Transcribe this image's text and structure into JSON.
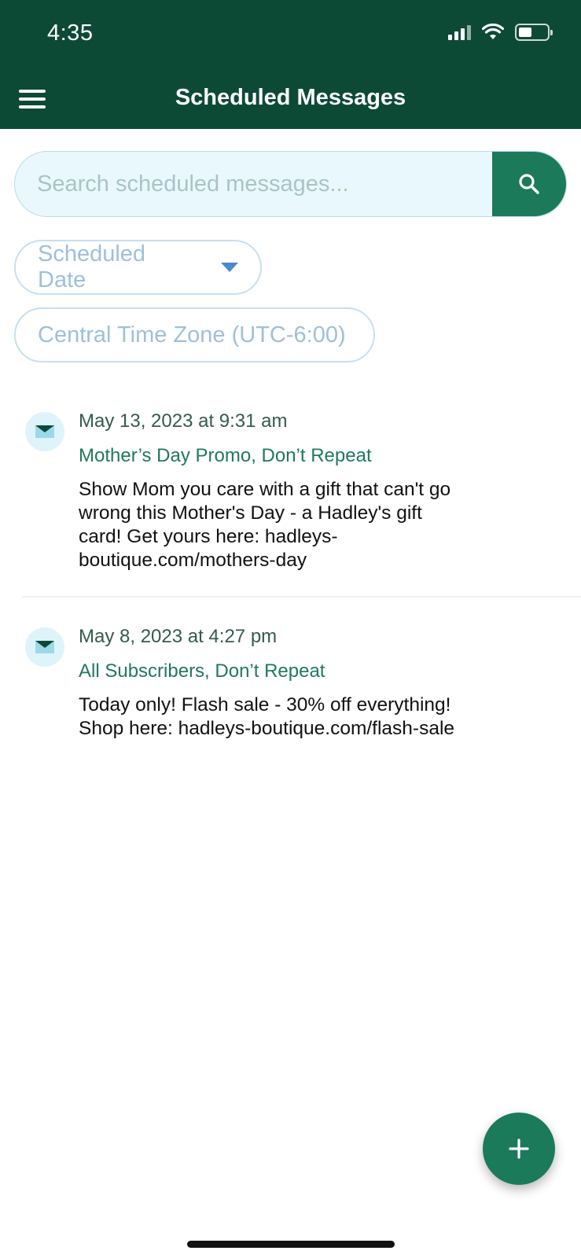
{
  "status_bar": {
    "time": "4:35",
    "icons": [
      "signal-icon",
      "wifi-icon",
      "battery-icon"
    ]
  },
  "app_bar": {
    "title": "Scheduled Messages",
    "menu_icon": "hamburger-menu-icon",
    "background_color": "#0d4a35"
  },
  "search": {
    "placeholder": "Search scheduled messages...",
    "value": "",
    "button_icon": "search-icon"
  },
  "filters": {
    "sort_by": "Scheduled Date",
    "time_zone": "Central Time Zone (UTC-6:00)"
  },
  "messages": [
    {
      "date": "May 13, 2023 at 9:31 am",
      "tags": "Mother’s Day Promo, Don’t Repeat",
      "body": "Show Mom you care with a gift that can't go wrong this Mother's Day - a Hadley's gift card! Get yours here: hadleys-boutique.com/mothers-day",
      "icon": "envelope-icon"
    },
    {
      "date": "May 8, 2023 at 4:27 pm",
      "tags": "All Subscribers, Don’t Repeat",
      "body": "Today only! Flash sale - 30% off everything! Shop here: hadleys-boutique.com/flash-sale",
      "icon": "envelope-icon"
    }
  ],
  "fab": {
    "icon": "plus-icon"
  },
  "colors": {
    "primary_dark": "#0d4a35",
    "accent": "#1b7a5a",
    "tag_text": "#1f7a58",
    "chip_border": "#c8dff0",
    "search_background": "#e9f8fd"
  }
}
